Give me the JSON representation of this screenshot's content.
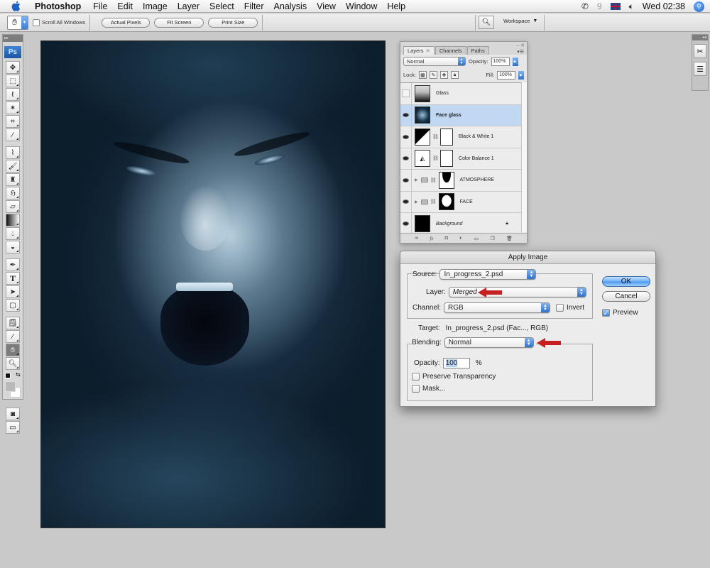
{
  "menubar": {
    "app_name": "Photoshop",
    "items": [
      "File",
      "Edit",
      "Image",
      "Layer",
      "Select",
      "Filter",
      "Analysis",
      "View",
      "Window",
      "Help"
    ],
    "clock": "Wed 02:38",
    "status_icons": [
      "phone-icon",
      "nine-icon",
      "uk-flag-icon",
      "volume-icon",
      "spotlight-icon"
    ]
  },
  "options_bar": {
    "active_tool": "hand-tool",
    "scroll_all_windows_label": "Scroll All Windows",
    "scroll_all_windows_checked": false,
    "buttons": [
      "Actual Pixels",
      "Fit Screen",
      "Print Size"
    ],
    "workspace_label": "Workspace"
  },
  "toolbox": {
    "logo": "Ps",
    "tools": [
      "move",
      "marquee",
      "lasso",
      "magic-wand",
      "crop",
      "slice",
      "healing-brush",
      "brush",
      "clone-stamp",
      "history-brush",
      "eraser",
      "gradient",
      "blur",
      "dodge",
      "pen",
      "type",
      "path-selection",
      "shape",
      "notes",
      "eyedropper",
      "hand",
      "zoom"
    ],
    "active_tool": "hand",
    "foreground_color": "#b9b9b9",
    "background_color": "#ffffff"
  },
  "layers_panel": {
    "tabs": [
      "Layers",
      "Channels",
      "Paths"
    ],
    "active_tab": "Layers",
    "blend_mode": "Normal",
    "opacity_label": "Opacity:",
    "opacity": "100%",
    "lock_label": "Lock:",
    "fill_label": "Fill:",
    "fill": "100%",
    "layers": [
      {
        "name": "Glass",
        "visible": false,
        "selected": false,
        "type": "pixel"
      },
      {
        "name": "Face glass",
        "visible": true,
        "selected": true,
        "type": "pixel"
      },
      {
        "name": "Black & White 1",
        "visible": true,
        "selected": false,
        "type": "adjustment"
      },
      {
        "name": "Color Balance 1",
        "visible": true,
        "selected": false,
        "type": "adjustment"
      },
      {
        "name": "ATMOSPHERE",
        "visible": true,
        "selected": false,
        "type": "group"
      },
      {
        "name": "FACE",
        "visible": true,
        "selected": false,
        "type": "group"
      },
      {
        "name": "Background",
        "visible": true,
        "selected": false,
        "type": "background",
        "locked": true
      }
    ],
    "footer_icons": [
      "link-icon",
      "fx-icon",
      "mask-icon",
      "adjustment-icon",
      "group-icon",
      "new-layer-icon",
      "trash-icon"
    ]
  },
  "apply_image": {
    "title": "Apply Image",
    "source_label": "Source:",
    "source": "In_progress_2.psd",
    "layer_label": "Layer:",
    "layer": "Merged",
    "channel_label": "Channel:",
    "channel": "RGB",
    "invert_label": "Invert",
    "invert_checked": false,
    "target_label": "Target:",
    "target": "In_progress_2.psd (Fac..., RGB)",
    "blending_label": "Blending:",
    "blending": "Normal",
    "opacity_label": "Opacity:",
    "opacity": "100",
    "opacity_unit": "%",
    "preserve_transparency_label": "Preserve Transparency",
    "preserve_transparency_checked": false,
    "mask_label": "Mask...",
    "mask_checked": false,
    "ok_label": "OK",
    "cancel_label": "Cancel",
    "preview_label": "Preview",
    "preview_checked": true,
    "annotation_color": "#c8201e"
  }
}
